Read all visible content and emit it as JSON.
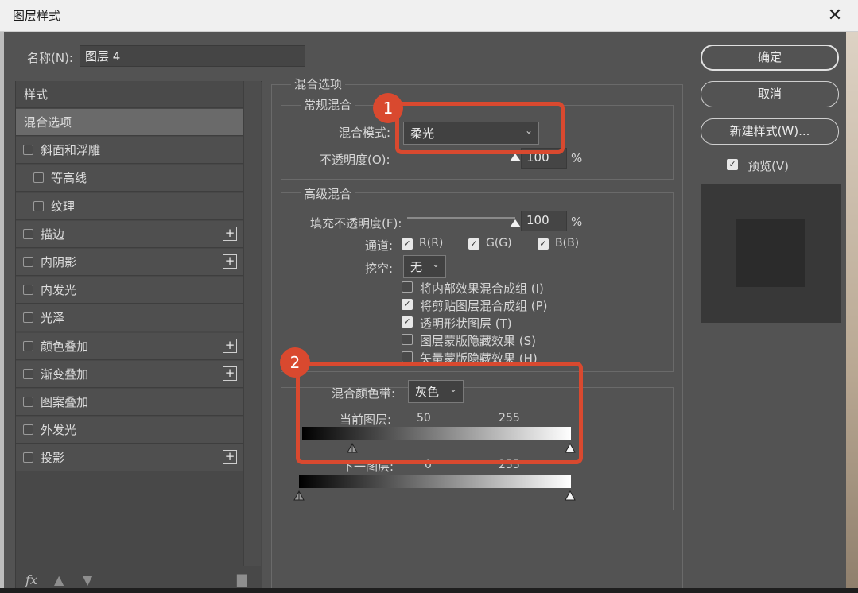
{
  "window": {
    "title": "图层样式"
  },
  "name_field": {
    "label": "名称(N):",
    "value": "图层 4"
  },
  "styles": {
    "header": "样式",
    "items": [
      {
        "label": "混合选项",
        "checkbox": false,
        "plus": false,
        "active": true
      },
      {
        "label": "斜面和浮雕",
        "checkbox": true,
        "plus": false
      },
      {
        "label": "等高线",
        "checkbox": true,
        "plus": false,
        "indent": true
      },
      {
        "label": "纹理",
        "checkbox": true,
        "plus": false,
        "indent": true
      },
      {
        "label": "描边",
        "checkbox": true,
        "plus": true
      },
      {
        "label": "内阴影",
        "checkbox": true,
        "plus": true
      },
      {
        "label": "内发光",
        "checkbox": true,
        "plus": false
      },
      {
        "label": "光泽",
        "checkbox": true,
        "plus": false
      },
      {
        "label": "颜色叠加",
        "checkbox": true,
        "plus": true
      },
      {
        "label": "渐变叠加",
        "checkbox": true,
        "plus": true
      },
      {
        "label": "图案叠加",
        "checkbox": true,
        "plus": false
      },
      {
        "label": "外发光",
        "checkbox": true,
        "plus": false
      },
      {
        "label": "投影",
        "checkbox": true,
        "plus": true
      }
    ],
    "footer_fx": "fx"
  },
  "blend_options": {
    "title": "混合选项",
    "general": {
      "title": "常规混合",
      "mode_label": "混合模式:",
      "mode_value": "柔光",
      "opacity_label": "不透明度(O):",
      "opacity_value": "100",
      "opacity_unit": "%",
      "opacity_level": 1.0
    },
    "advanced": {
      "title": "高级混合",
      "fill_label": "填充不透明度(F):",
      "fill_value": "100",
      "fill_unit": "%",
      "fill_level": 1.0,
      "channels_label": "通道:",
      "channels": [
        {
          "label": "R(R)",
          "checked": true
        },
        {
          "label": "G(G)",
          "checked": true
        },
        {
          "label": "B(B)",
          "checked": true
        }
      ],
      "knockout_label": "挖空:",
      "knockout_value": "无",
      "options": [
        {
          "label": "将内部效果混合成组 (I)",
          "checked": false
        },
        {
          "label": "将剪贴图层混合成组 (P)",
          "checked": true
        },
        {
          "label": "透明形状图层 (T)",
          "checked": true
        },
        {
          "label": "图层蒙版隐藏效果 (S)",
          "checked": false
        },
        {
          "label": "矢量蒙版隐藏效果 (H)",
          "checked": false
        }
      ]
    },
    "blend_if": {
      "label": "混合颜色带:",
      "value": "灰色",
      "this_layer_label": "当前图层:",
      "this_layer_low": "50",
      "this_layer_high": "255",
      "underlying_label": "下一图层:",
      "underlying_low": "0",
      "underlying_high": "255"
    }
  },
  "buttons": {
    "ok": "确定",
    "cancel": "取消",
    "new_style": "新建样式(W)...",
    "preview_label": "预览(V)",
    "preview_checked": true
  },
  "annotations": [
    {
      "number": "1"
    },
    {
      "number": "2"
    }
  ],
  "colors": {
    "dialog_bg": "#535353",
    "annotation_red": "#d9492f"
  }
}
